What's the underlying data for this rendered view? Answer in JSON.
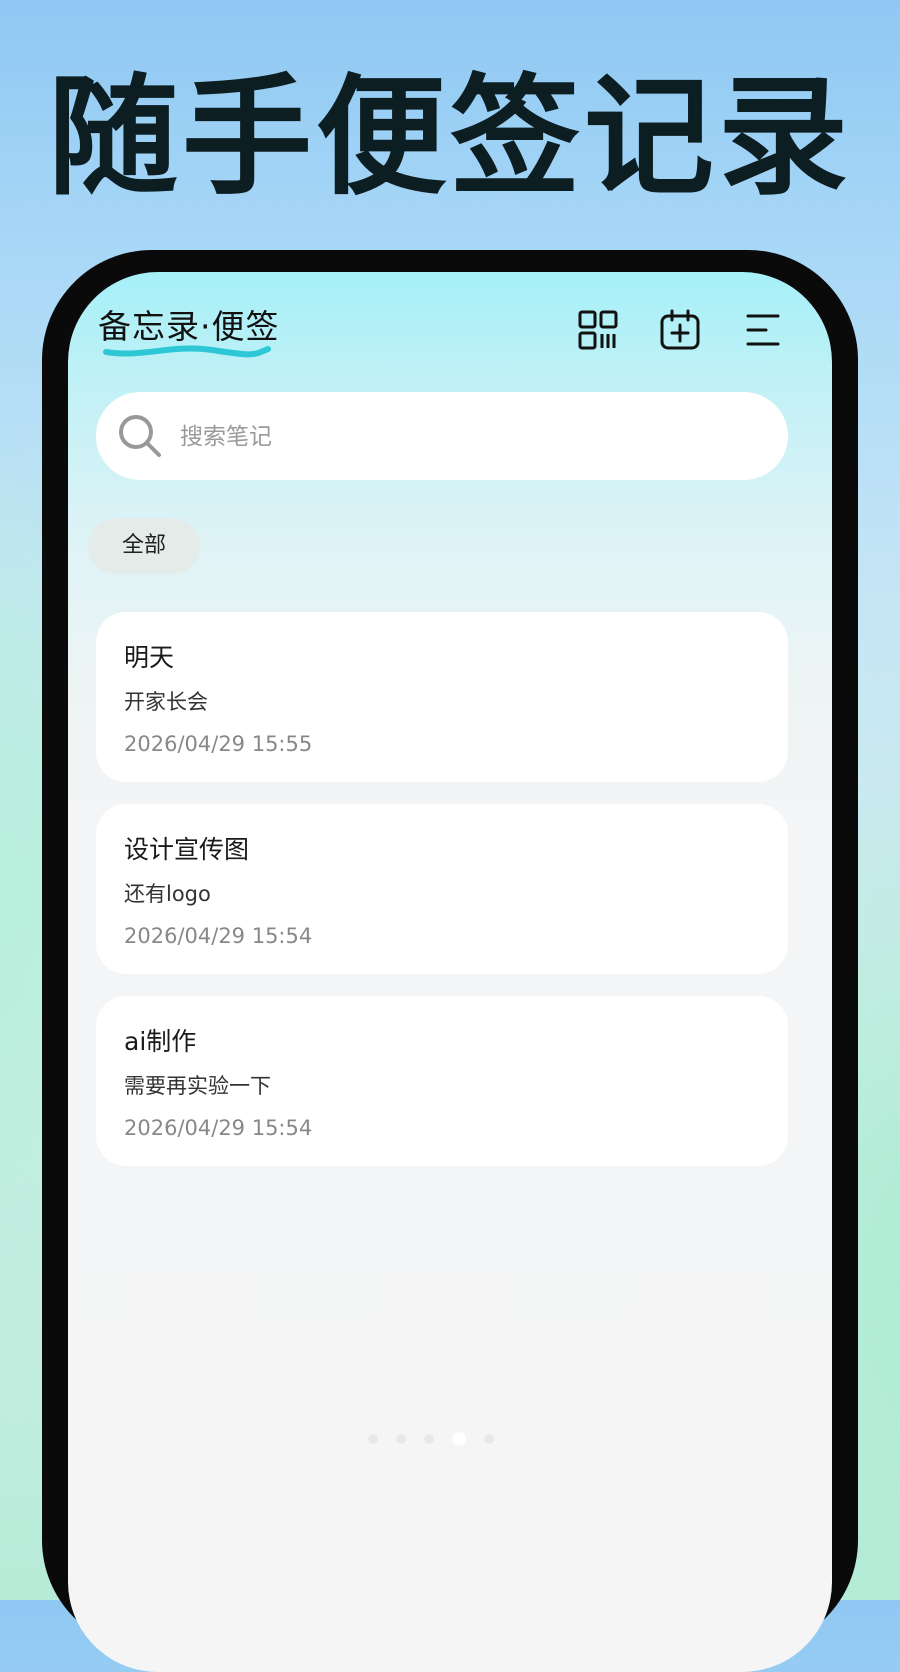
{
  "headline": "随手便签记录",
  "app": {
    "title": "备忘录·便签",
    "accent_color": "#2ec7d6",
    "top_icons": [
      "qr-code-icon",
      "calendar-add-icon",
      "menu-icon"
    ]
  },
  "search": {
    "placeholder": "搜索笔记",
    "value": ""
  },
  "category": {
    "selected": "全部"
  },
  "notes": [
    {
      "title": "明天",
      "body": "开家长会",
      "time": "2026/04/29 15:55"
    },
    {
      "title": "设计宣传图",
      "body": "还有logo",
      "time": "2026/04/29 15:54"
    },
    {
      "title": "ai制作",
      "body": "需要再实验一下",
      "time": "2026/04/29 15:54"
    }
  ]
}
